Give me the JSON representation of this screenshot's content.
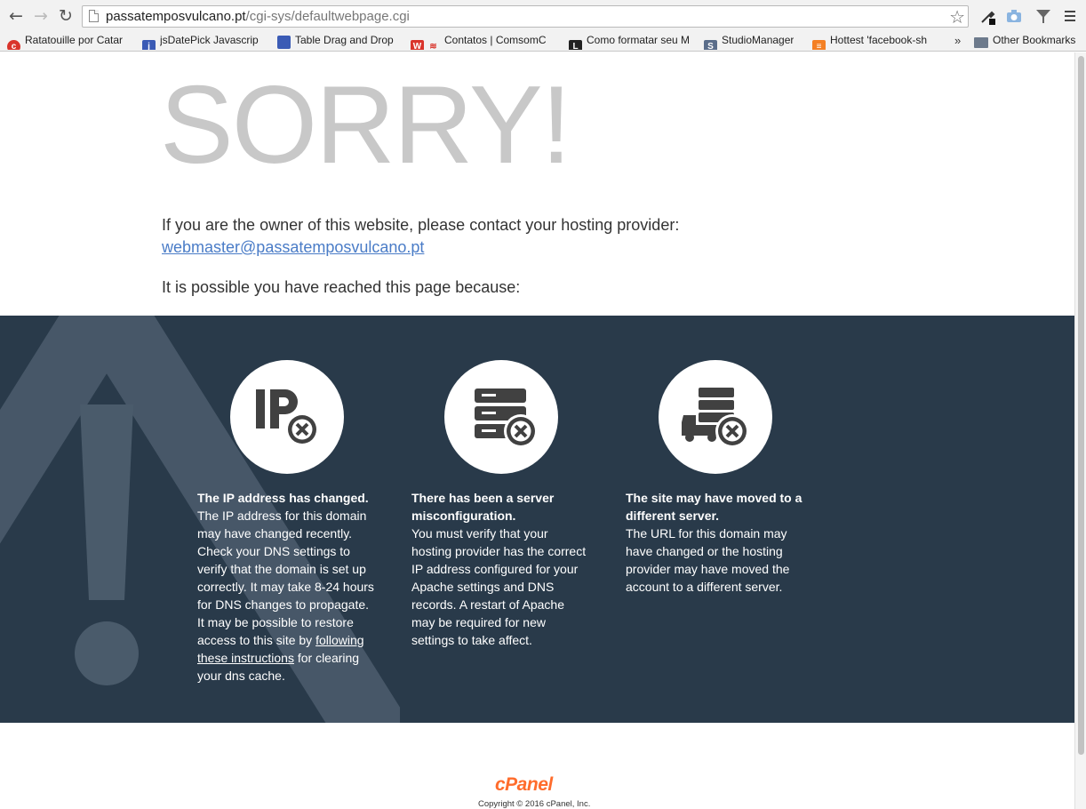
{
  "browser": {
    "back_icon": "arrow-left-icon",
    "forward_icon": "arrow-right-icon",
    "reload_icon": "reload-icon",
    "url_domain": "passatemposvulcano.pt",
    "url_path": "/cgi-sys/defaultwebpage.cgi",
    "bookmarks": [
      {
        "label": "Ratatouille por Catar",
        "color": "#d9342b"
      },
      {
        "label": "jsDatePick Javascrip",
        "color": "#3b5bb5"
      },
      {
        "label": "Table Drag and Drop",
        "color": "#3b5bb5"
      },
      {
        "label": "Contatos | ComsomC",
        "color": "#d9342b"
      },
      {
        "label": "Como formatar seu M",
        "color": "#222222"
      },
      {
        "label": "StudioManager",
        "color": "#5a6d8a"
      },
      {
        "label": "Hottest 'facebook-sh",
        "color": "#f48024"
      }
    ],
    "bookmarks_more": "»",
    "other_bookmarks": "Other Bookmarks"
  },
  "page": {
    "heading": "SORRY!",
    "owner_text": "If you are the owner of this website, please contact your hosting provider:",
    "email": "webmaster@passatemposvulcano.pt",
    "reason_intro": "It is possible you have reached this page because:",
    "reasons": [
      {
        "icon": "ip-error-icon",
        "title": "The IP address has changed.",
        "body_before": "The IP address for this domain may have changed recently. Check your DNS settings to verify that the domain is set up correctly. It may take 8-24 hours for DNS changes to propagate. It may be possible to restore access to this site by ",
        "link": "following these instructions",
        "body_after": " for clearing your dns cache."
      },
      {
        "icon": "server-error-icon",
        "title": "There has been a server misconfiguration.",
        "body": "You must verify that your hosting provider has the correct IP address configured for your Apache settings and DNS records. A restart of Apache may be required for new settings to take affect."
      },
      {
        "icon": "server-moved-icon",
        "title": "The site may have moved to a different server.",
        "body": "The URL for this domain may have changed or the hosting provider may have moved the account to a different server."
      }
    ],
    "footer_logo": "cPanel",
    "copyright": "Copyright © 2016 cPanel, Inc."
  }
}
